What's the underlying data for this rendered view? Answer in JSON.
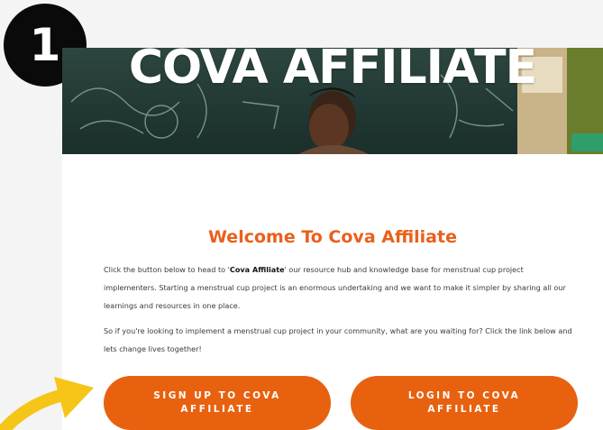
{
  "step_badge": "1",
  "hero": {
    "title": "COVA AFFILIATE"
  },
  "welcome": {
    "title": "Welcome To Cova Affiliate"
  },
  "intro": {
    "before": "Click the button below to head to '",
    "bold": "Cova Affiliate",
    "after": "' our resource hub and knowledge base for menstrual cup project implementers. Starting a menstrual cup project is an enormous undertaking and we want to make it simpler by sharing all our learnings and resources in one place."
  },
  "cta_text": "So if you're looking to implement a menstrual cup project in your community, what are you waiting for? Click the link below and lets change lives together!",
  "buttons": {
    "signup_line1": "SIGN UP TO COVA",
    "signup_line2": "AFFILIATE",
    "login_line1": "LOGIN TO COVA",
    "login_line2": "AFFILIATE"
  },
  "colors": {
    "accent": "#e8610f",
    "title": "#e9601c",
    "badge": "#0a0a0a",
    "arrow": "#f5c518"
  },
  "icons": {
    "arrow": "curved-arrow-icon"
  }
}
